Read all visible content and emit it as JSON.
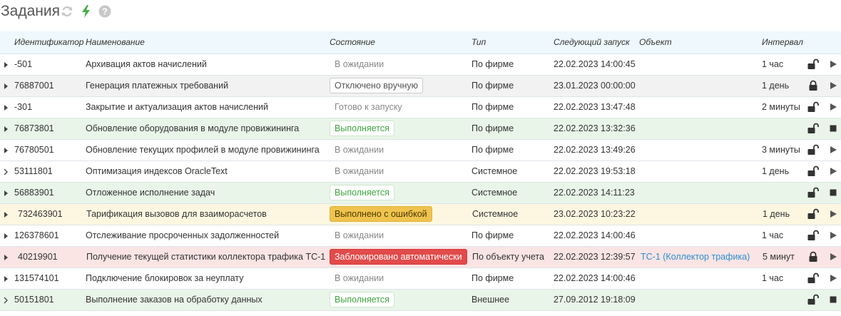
{
  "title": "Задания",
  "header_icons": [
    "refresh-icon",
    "lightning-icon",
    "help-icon"
  ],
  "colors": {
    "lightning": "#44b044",
    "header_bg": "#eef8fd",
    "row_green": "#e9f5e9",
    "row_yellow": "#fdf7e2",
    "row_red": "#fbe4e4",
    "row_gray": "#f2f2f2",
    "link": "#2b8fd1"
  },
  "columns": {
    "id": "Идентификатор",
    "name": "Наименование",
    "state": "Состояние",
    "type": "Тип",
    "next_run": "Следующий запуск",
    "object": "Объект",
    "interval": "Интервал"
  },
  "rows": [
    {
      "expander": "filled",
      "id": "-501",
      "name": "Архивация актов начислений",
      "state": "В ожидании",
      "state_style": "plain",
      "type": "По фирме",
      "next_run": "22.02.2023 14:00:45",
      "object": "",
      "interval": "1 час",
      "lock": "open",
      "action": "play",
      "bg": "white"
    },
    {
      "expander": "filled",
      "id": "76887001",
      "name": "Генерация платежных требований",
      "state": "Отключено вручную",
      "state_style": "outline",
      "type": "По фирме",
      "next_run": "23.01.2023 00:00:00",
      "object": "",
      "interval": "1 день",
      "lock": "closed",
      "action": "play",
      "bg": "gray"
    },
    {
      "expander": "filled",
      "id": "-301",
      "name": "Закрытие и актуализация актов начислений",
      "state": "Готово к запуску",
      "state_style": "plain",
      "type": "По фирме",
      "next_run": "22.02.2023 13:47:48",
      "object": "",
      "interval": "2 минуты",
      "lock": "open",
      "action": "play",
      "bg": "white"
    },
    {
      "expander": "filled",
      "id": "76873801",
      "name": "Обновление оборудования в модуле провижининга",
      "state": "Выполняется",
      "state_style": "green",
      "type": "По фирме",
      "next_run": "22.02.2023 13:32:36",
      "object": "",
      "interval": "",
      "lock": "open",
      "action": "stop",
      "bg": "green"
    },
    {
      "expander": "filled",
      "id": "76780501",
      "name": "Обновление текущих профилей в модуле провижининга",
      "state": "В ожидании",
      "state_style": "plain",
      "type": "По фирме",
      "next_run": "22.02.2023 13:49:26",
      "object": "",
      "interval": "3 минуты",
      "lock": "open",
      "action": "play",
      "bg": "white"
    },
    {
      "expander": "outline",
      "id": "53111801",
      "name": "Оптимизация индексов OracleText",
      "state": "В ожидании",
      "state_style": "plain",
      "type": "Системное",
      "next_run": "22.02.2023 19:53:18",
      "object": "",
      "interval": "1 день",
      "lock": "open",
      "action": "play",
      "bg": "white"
    },
    {
      "expander": "filled",
      "id": "56883901",
      "name": "Отложенное исполнение задач",
      "state": "Выполняется",
      "state_style": "green",
      "type": "Системное",
      "next_run": "22.02.2023 14:11:23",
      "object": "",
      "interval": "",
      "lock": "open",
      "action": "stop",
      "bg": "green"
    },
    {
      "expander": "filled",
      "id": "732463901",
      "name": "Тарификация вызовов для взаиморасчетов",
      "state": "Выполнено с ошибкой",
      "state_style": "yellow",
      "type": "Системное",
      "next_run": "23.02.2023 10:23:22",
      "object": "",
      "interval": "1 день",
      "lock": "open",
      "action": "play",
      "bg": "yellow"
    },
    {
      "expander": "filled",
      "id": "126378601",
      "name": "Отслеживание просроченных задолженностей",
      "state": "В ожидании",
      "state_style": "plain",
      "type": "По фирме",
      "next_run": "22.02.2023 14:00:46",
      "object": "",
      "interval": "1 час",
      "lock": "open",
      "action": "play",
      "bg": "white"
    },
    {
      "expander": "filled",
      "id": "40219901",
      "name": "Получение текущей статистики коллектора трафика ТС-1",
      "state": "Заблокировано автоматически",
      "state_style": "red",
      "type": "По объекту учета",
      "next_run": "22.02.2023 12:39:57",
      "object": "ТС-1 (Коллектор трафика)",
      "interval": "5 минут",
      "lock": "closed",
      "action": "play",
      "bg": "red"
    },
    {
      "expander": "filled",
      "id": "131574101",
      "name": "Подключение блокировок за неуплату",
      "state": "В ожидании",
      "state_style": "plain",
      "type": "По фирме",
      "next_run": "22.02.2023 14:00:46",
      "object": "",
      "interval": "1 час",
      "lock": "open",
      "action": "play",
      "bg": "white"
    },
    {
      "expander": "outline",
      "id": "50151801",
      "name": "Выполнение заказов на обработку данных",
      "state": "Выполняется",
      "state_style": "green",
      "type": "Внешнее",
      "next_run": "27.09.2012 19:18:09",
      "object": "",
      "interval": "",
      "lock": "open",
      "action": "stop",
      "bg": "green"
    }
  ]
}
